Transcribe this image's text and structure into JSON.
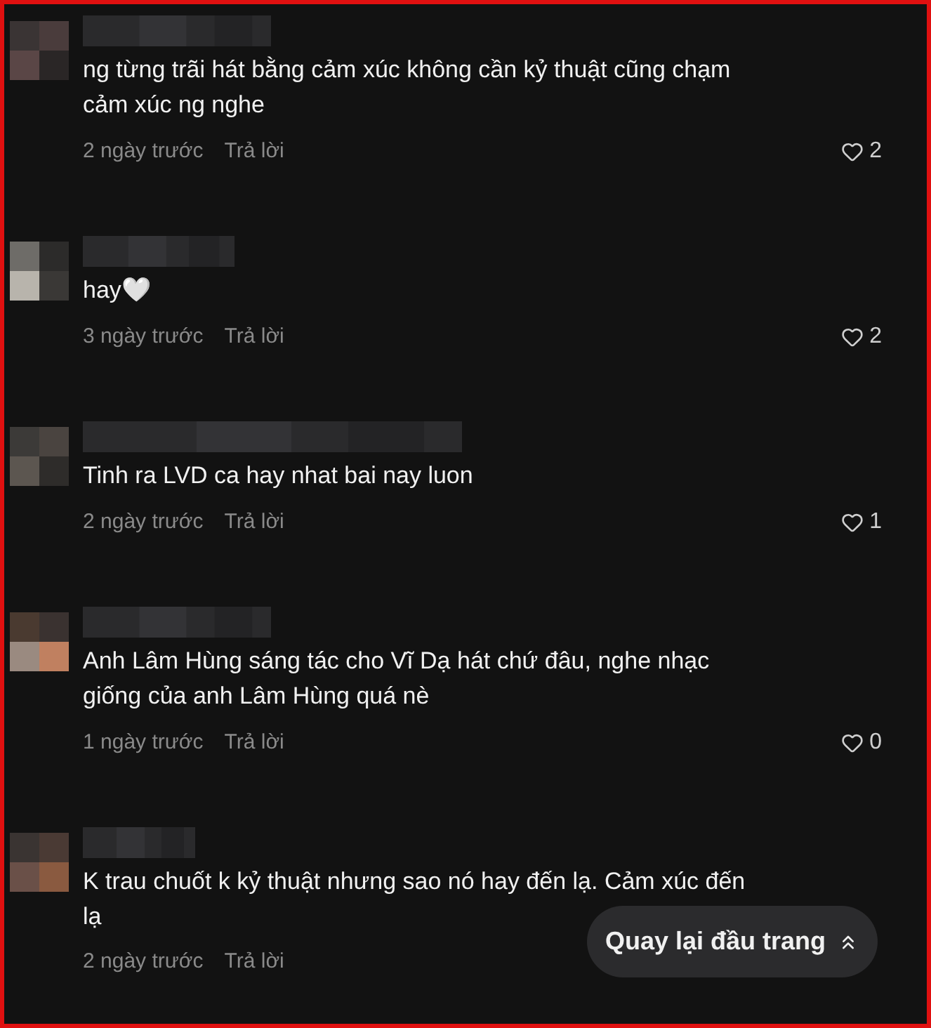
{
  "comments": [
    {
      "text": "ng từng trãi hát bằng cảm xúc không cần kỷ thuật cũng chạm cảm xúc ng nghe",
      "time": "2 ngày trước",
      "reply": "Trả lời",
      "likes": "2"
    },
    {
      "text": "hay🤍",
      "time": "3 ngày trước",
      "reply": "Trả lời",
      "likes": "2"
    },
    {
      "text": "Tinh ra LVD ca hay nhat bai nay luon",
      "time": "2 ngày trước",
      "reply": "Trả lời",
      "likes": "1"
    },
    {
      "text": "Anh Lâm Hùng sáng tác cho Vĩ Dạ hát chứ đâu, nghe nhạc giống của anh Lâm Hùng quá nè",
      "time": "1 ngày trước",
      "reply": "Trả lời",
      "likes": "0"
    },
    {
      "text": "K trau chuốt k kỷ thuật nhưng sao nó hay đến lạ. Cảm xúc đến lạ",
      "time": "2 ngày trước",
      "reply": "Trả lời"
    }
  ],
  "back_to_top": {
    "label": "Quay lại đầu trang"
  }
}
